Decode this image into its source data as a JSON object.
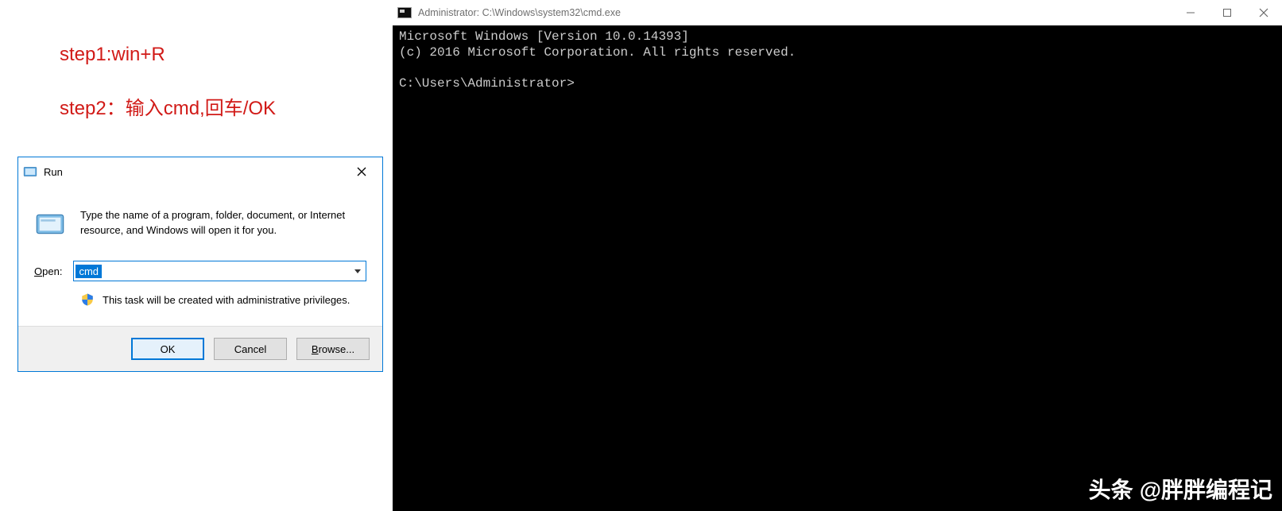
{
  "steps": {
    "step1": "step1:win+R",
    "step2": "step2：输入cmd,回车/OK"
  },
  "run_dialog": {
    "title": "Run",
    "instruction": "Type the name of a program, folder, document, or Internet resource, and Windows will open it for you.",
    "open_label": "Open:",
    "open_value": "cmd",
    "admin_note": "This task will be created with administrative privileges.",
    "buttons": {
      "ok": "OK",
      "cancel": "Cancel",
      "browse": "Browse..."
    }
  },
  "cmd": {
    "title": "Administrator: C:\\Windows\\system32\\cmd.exe",
    "line1": "Microsoft Windows [Version 10.0.14393]",
    "line2": "(c) 2016 Microsoft Corporation. All rights reserved.",
    "prompt": "C:\\Users\\Administrator>"
  },
  "watermark": {
    "prefix": "头条",
    "handle": "@胖胖编程记"
  }
}
